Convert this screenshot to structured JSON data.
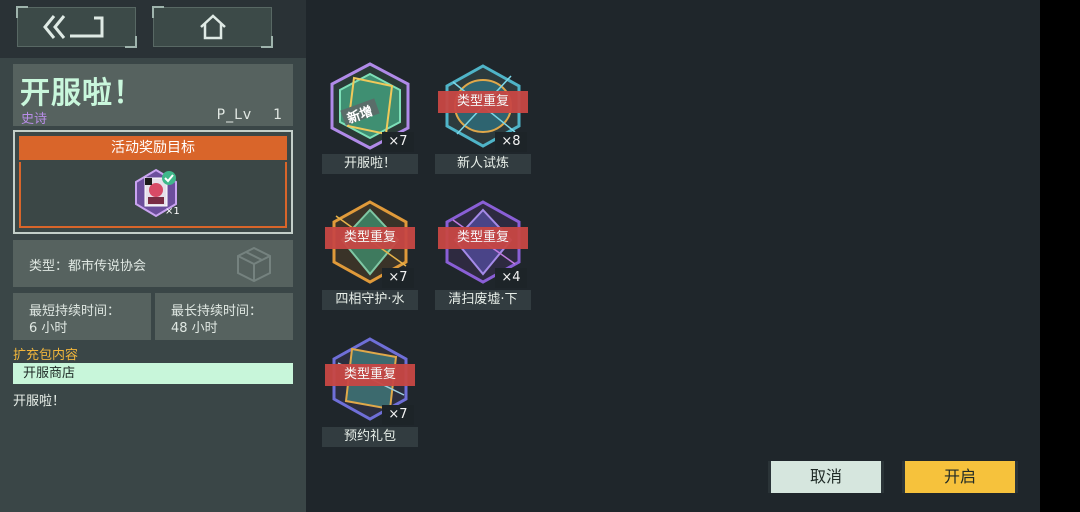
{
  "nav": {
    "back_icon": "back-arrow-icon",
    "home_icon": "home-icon"
  },
  "event": {
    "title": "开服啦！",
    "rarity": "史诗",
    "plv_label": "P_Lv",
    "plv_value": "1",
    "reward_header": "活动奖励目标",
    "reward_count": "×1",
    "type_text": "类型：都市传说协会",
    "min_duration_label": "最短持续时间：",
    "min_duration_value": "6 小时",
    "max_duration_label": "最长持续时间：",
    "max_duration_value": "48 小时",
    "pack_label": "扩充包内容",
    "pack_item": "开服商店",
    "pack_desc": "开服啦！"
  },
  "packs": [
    {
      "name": "开服啦！",
      "count": "×7",
      "badge": "",
      "stamp": "新增",
      "color": "#7de0b8"
    },
    {
      "name": "新人试炼",
      "count": "×8",
      "badge": "类型重复",
      "stamp": "",
      "color": "#4fb4c8"
    },
    {
      "name": "四相守护·水",
      "count": "×7",
      "badge": "类型重复",
      "stamp": "",
      "color": "#e09a3a"
    },
    {
      "name": "清扫废墟·下",
      "count": "×4",
      "badge": "类型重复",
      "stamp": "",
      "color": "#8a5fd6"
    },
    {
      "name": "预约礼包",
      "count": "×7",
      "badge": "类型重复",
      "stamp": "",
      "color": "#6f6fd8"
    }
  ],
  "actions": {
    "cancel": "取消",
    "start": "开启"
  },
  "colors": {
    "accent_orange": "#d9652a",
    "duplicate_red": "#c84744",
    "start_yellow": "#f6c23c",
    "rarity_purple": "#b88de8"
  }
}
